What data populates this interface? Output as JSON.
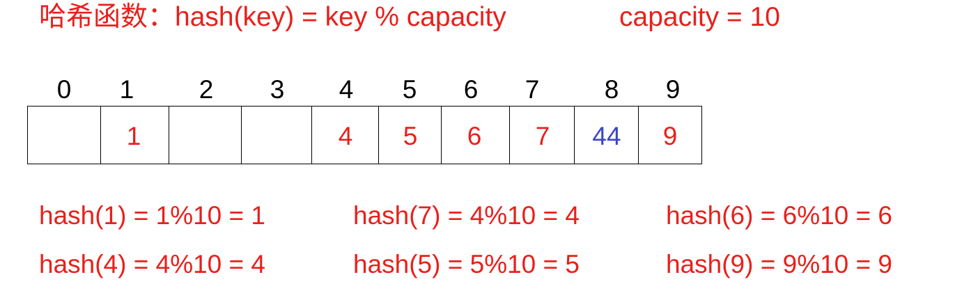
{
  "header": {
    "title": "哈希函数：hash(key) = key % capacity",
    "capacity": "capacity = 10"
  },
  "table": {
    "indices": [
      "0",
      "1",
      "2",
      "3",
      "4",
      "5",
      "6",
      "7",
      "8",
      "9"
    ],
    "slots": [
      {
        "value": "",
        "color": "#e8201c"
      },
      {
        "value": "1",
        "color": "#e8201c"
      },
      {
        "value": "",
        "color": "#e8201c"
      },
      {
        "value": "",
        "color": "#e8201c"
      },
      {
        "value": "4",
        "color": "#e8201c"
      },
      {
        "value": "5",
        "color": "#e8201c"
      },
      {
        "value": "6",
        "color": "#e8201c"
      },
      {
        "value": "7",
        "color": "#e8201c"
      },
      {
        "value": "44",
        "color": "#3c46c8"
      },
      {
        "value": "9",
        "color": "#e8201c"
      }
    ]
  },
  "equations": [
    "hash(1) = 1%10 = 1",
    "hash(7) = 4%10 = 4",
    "hash(6) = 6%10 = 6",
    "hash(4) = 4%10 = 4",
    "hash(5) = 5%10 = 5",
    "hash(9) = 9%10 = 9"
  ]
}
